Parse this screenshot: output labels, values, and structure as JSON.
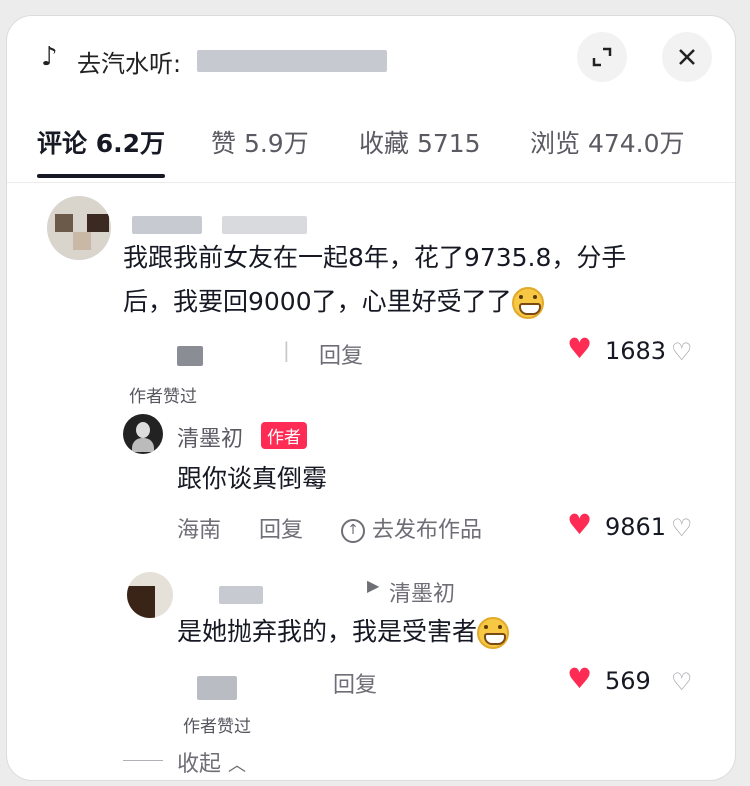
{
  "header": {
    "title": "去汽水听:",
    "expand_icon": "expand-icon",
    "close_icon": "close-icon"
  },
  "tabs": [
    {
      "label": "评论 6.2万"
    },
    {
      "label": "赞 5.9万"
    },
    {
      "label": "收藏 5715"
    },
    {
      "label": "浏览 474.0万"
    }
  ],
  "comments": [
    {
      "text_line1": "我跟我前女友在一起8年，花了9735.8，分手",
      "text_line2": "后，我要回9000了，心里好受了了",
      "reply_label": "回复",
      "likes": "1683",
      "author_liked": "作者赞过"
    },
    {
      "author": "清墨初",
      "badge": "作者",
      "text": "跟你谈真倒霉",
      "location": "海南",
      "reply_label": "回复",
      "publish_label": "去发布作品",
      "likes": "9861"
    },
    {
      "reply_to": "清墨初",
      "text": "是她抛弃我的，我是受害者",
      "reply_label": "回复",
      "likes": "569",
      "author_liked": "作者赞过"
    }
  ],
  "collapse_label": "收起",
  "colors": {
    "accent": "#fe2c55",
    "text": "#161823",
    "muted": "#6e6e76"
  }
}
